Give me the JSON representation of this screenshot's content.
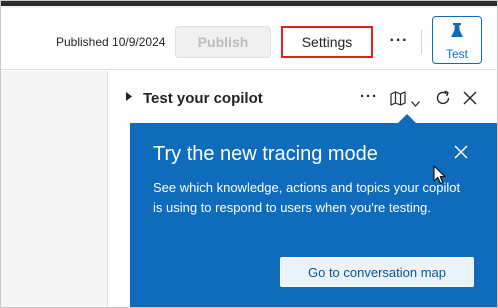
{
  "toolbar": {
    "published_text": "Published 10/9/2024",
    "publish_label": "Publish",
    "settings_label": "Settings",
    "more_label": "···",
    "test_label": "Test"
  },
  "panel": {
    "title": "Test your copilot",
    "more_label": "···"
  },
  "callout": {
    "title": "Try the new tracing mode",
    "body": "See which knowledge, actions and topics your copilot is using to respond to users when you're testing.",
    "button_label": "Go to conversation map"
  },
  "icons": {
    "test": "flask-icon",
    "panel_expand": "caret-right-icon",
    "map": "map-icon",
    "chevron": "chevron-down-icon",
    "refresh": "refresh-icon",
    "close": "close-icon",
    "callout_close": "close-icon",
    "cursor": "mouse-pointer-icon"
  },
  "colors": {
    "accent": "#0f6cbd",
    "highlight_box": "#e0201b",
    "callout_button_bg": "#ebf3fc"
  }
}
